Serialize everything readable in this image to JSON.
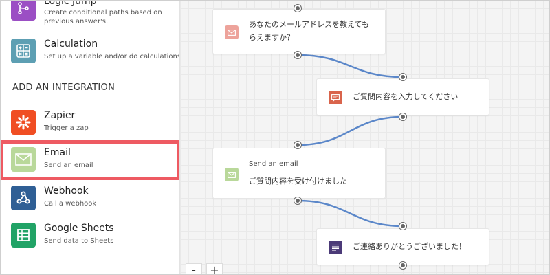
{
  "sidebar": {
    "logic_jump": {
      "title": "Logic Jump",
      "desc": "Create conditional paths based on previous answer's."
    },
    "calculation": {
      "title": "Calculation",
      "desc": "Set up a variable and/or do calculations"
    },
    "section_heading": "ADD AN INTEGRATION",
    "zapier": {
      "title": "Zapier",
      "desc": "Trigger a zap"
    },
    "email": {
      "title": "Email",
      "desc": "Send an email"
    },
    "webhook": {
      "title": "Webhook",
      "desc": "Call a webhook"
    },
    "google_sheets": {
      "title": "Google Sheets",
      "desc": "Send data to Sheets"
    }
  },
  "canvas": {
    "cards": {
      "email_question": {
        "line1": "あなたのメールアドレスを教えても",
        "line2": "らえますか？"
      },
      "inquiry": {
        "text": "ご質問内容を入力してください"
      },
      "send_email": {
        "title": "Send an email",
        "text": "ご質問内容を受け付けました"
      },
      "thanks": {
        "text": "ご連絡ありがとうございました！"
      }
    },
    "zoom": {
      "minus": "-",
      "plus": "+"
    }
  },
  "colors": {
    "highlight": "#ee5a62",
    "connector": "#5b87c9",
    "logic_jump": "#9b4fc4",
    "calculation": "#5d9fb3",
    "zapier": "#f04e23",
    "email": "#b9d89a",
    "webhook": "#2f5f95",
    "google_sheets": "#21a366",
    "email_card_icon": "#eda39b",
    "inquiry_card_icon": "#d9644c",
    "thanks_card_icon": "#4b3a78"
  }
}
